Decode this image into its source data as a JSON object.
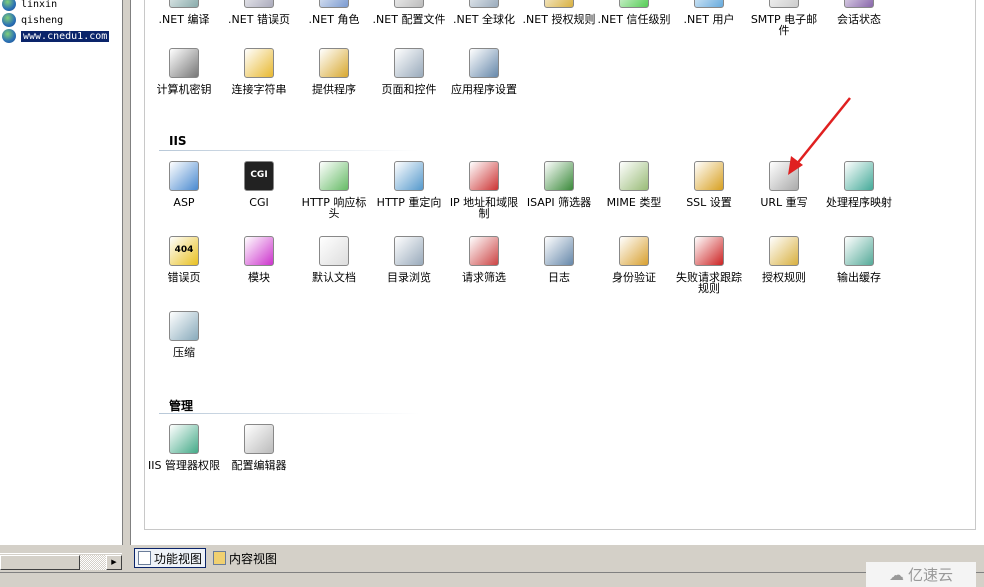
{
  "tree": {
    "items": [
      {
        "label": "linxin"
      },
      {
        "label": "qisheng"
      },
      {
        "label": "www.cnedu1.com",
        "selected": true
      }
    ]
  },
  "aspnet_row1": [
    {
      "label": ".NET 编译",
      "icon": "compile-icon",
      "color": "#8aa"
    },
    {
      "label": ".NET 错误页",
      "icon": "error-page-icon",
      "color": "#aab"
    },
    {
      "label": ".NET 角色",
      "icon": "roles-icon",
      "color": "#7a9ad0"
    },
    {
      "label": ".NET 配置文件",
      "icon": "profile-icon",
      "color": "#bbb"
    },
    {
      "label": ".NET 全球化",
      "icon": "globalization-icon",
      "color": "#9ab"
    },
    {
      "label": ".NET 授权规则",
      "icon": "authorization-icon",
      "color": "#d8b040"
    },
    {
      "label": ".NET 信任级别",
      "icon": "trust-level-icon",
      "color": "#5c5"
    },
    {
      "label": ".NET 用户",
      "icon": "users-icon",
      "color": "#6ad"
    },
    {
      "label": "SMTP 电子邮件",
      "icon": "smtp-icon",
      "color": "#ccc"
    },
    {
      "label": "会话状态",
      "icon": "session-state-icon",
      "color": "#86a"
    }
  ],
  "aspnet_row2": [
    {
      "label": "计算机密钥",
      "icon": "machine-key-icon",
      "color": "#777"
    },
    {
      "label": "连接字符串",
      "icon": "connection-string-icon",
      "color": "#e8b830"
    },
    {
      "label": "提供程序",
      "icon": "providers-icon",
      "color": "#d8a830"
    },
    {
      "label": "页面和控件",
      "icon": "pages-controls-icon",
      "color": "#9ab"
    },
    {
      "label": "应用程序设置",
      "icon": "app-settings-icon",
      "color": "#68a"
    }
  ],
  "iis": {
    "title": "IIS",
    "items": [
      {
        "label": "ASP",
        "icon": "asp-icon",
        "color": "#4a8ad0"
      },
      {
        "label": "CGI",
        "icon": "cgi-icon",
        "color": "#222",
        "text": "CGI"
      },
      {
        "label": "HTTP 响应标头",
        "icon": "http-headers-icon",
        "color": "#6b6"
      },
      {
        "label": "HTTP 重定向",
        "icon": "http-redirect-icon",
        "color": "#59c"
      },
      {
        "label": "IP 地址和域限制",
        "icon": "ip-restrictions-icon",
        "color": "#c33"
      },
      {
        "label": "ISAPI 筛选器",
        "icon": "isapi-filters-icon",
        "color": "#3a8a3a"
      },
      {
        "label": "MIME 类型",
        "icon": "mime-types-icon",
        "color": "#9b7"
      },
      {
        "label": "SSL 设置",
        "icon": "ssl-lock-icon",
        "color": "#d8a020"
      },
      {
        "label": "URL 重写",
        "icon": "url-rewrite-icon",
        "color": "#aaa"
      },
      {
        "label": "处理程序映射",
        "icon": "handler-mappings-icon",
        "color": "#4a9"
      },
      {
        "label": "错误页",
        "icon": "error-pages-icon",
        "color": "#e8c020",
        "text": "404"
      },
      {
        "label": "模块",
        "icon": "modules-icon",
        "color": "#c3c"
      },
      {
        "label": "默认文档",
        "icon": "default-document-icon",
        "color": "#ddd"
      },
      {
        "label": "目录浏览",
        "icon": "directory-browsing-icon",
        "color": "#9ab"
      },
      {
        "label": "请求筛选",
        "icon": "request-filtering-icon",
        "color": "#c44"
      },
      {
        "label": "日志",
        "icon": "logging-icon",
        "color": "#68a"
      },
      {
        "label": "身份验证",
        "icon": "authentication-icon",
        "color": "#d8a030"
      },
      {
        "label": "失败请求跟踪规则",
        "icon": "failed-request-tracing-icon",
        "color": "#c22"
      },
      {
        "label": "授权规则",
        "icon": "authorization-rules-icon",
        "color": "#d8b040"
      },
      {
        "label": "输出缓存",
        "icon": "output-caching-icon",
        "color": "#5a9"
      },
      {
        "label": "压缩",
        "icon": "compression-icon",
        "color": "#8ab"
      }
    ]
  },
  "management": {
    "title": "管理",
    "items": [
      {
        "label": "IIS 管理器权限",
        "icon": "iis-manager-permissions-icon",
        "color": "#4a8"
      },
      {
        "label": "配置编辑器",
        "icon": "configuration-editor-icon",
        "color": "#bbb"
      }
    ]
  },
  "bottom": {
    "features_view": "功能视图",
    "content_view": "内容视图"
  },
  "watermark": "亿速云",
  "annotation_color": "#e02020"
}
